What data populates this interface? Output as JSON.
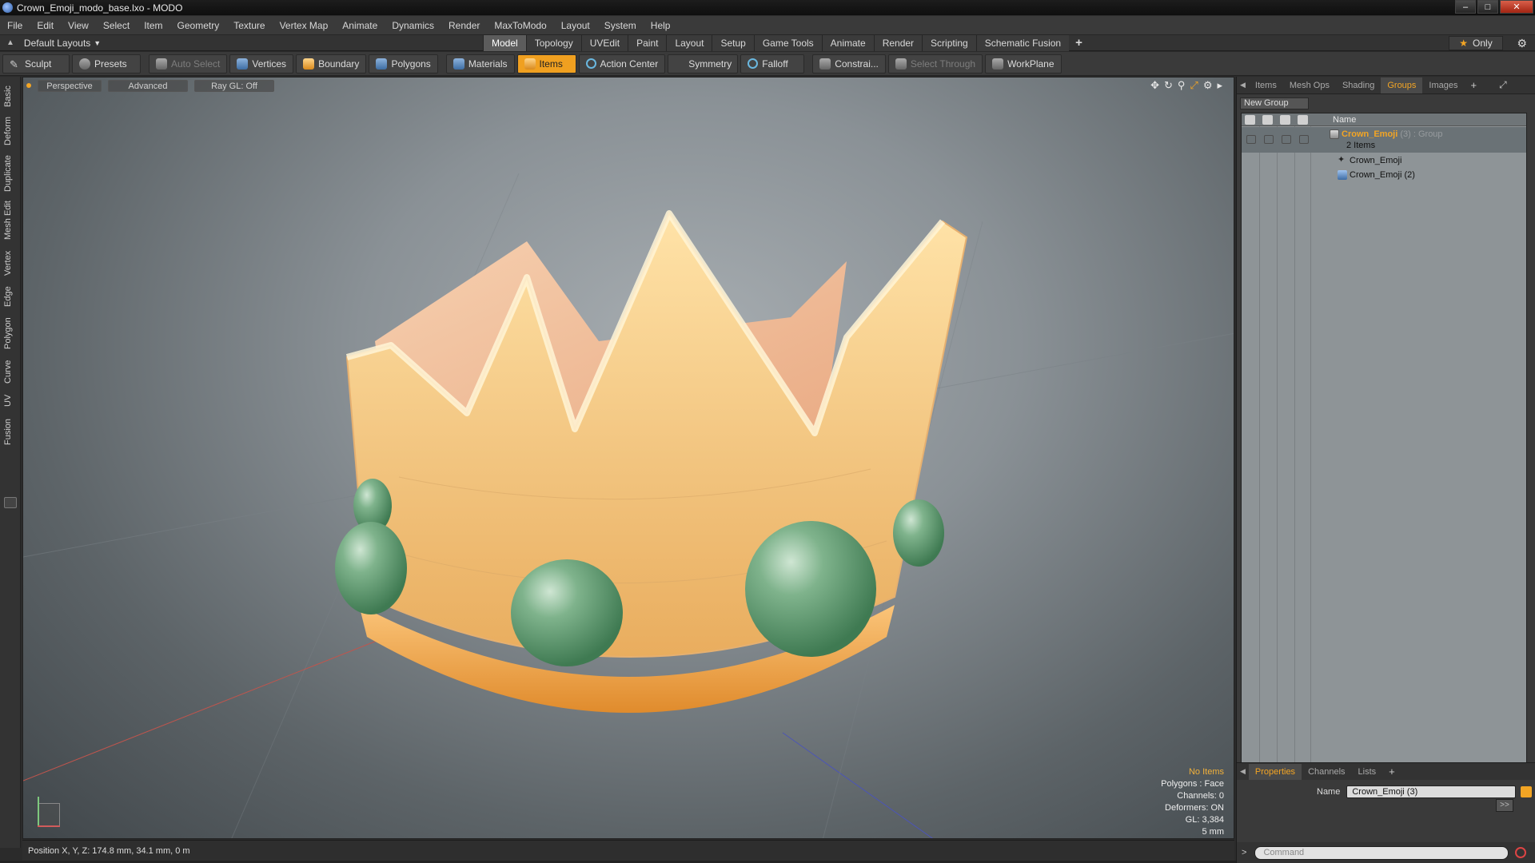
{
  "window": {
    "title": "Crown_Emoji_modo_base.lxo - MODO"
  },
  "menu": [
    "File",
    "Edit",
    "View",
    "Select",
    "Item",
    "Geometry",
    "Texture",
    "Vertex Map",
    "Animate",
    "Dynamics",
    "Render",
    "MaxToModo",
    "Layout",
    "System",
    "Help"
  ],
  "layout": {
    "selector": "Default Layouts",
    "tabs": [
      "Model",
      "Topology",
      "UVEdit",
      "Paint",
      "Layout",
      "Setup",
      "Game Tools",
      "Animate",
      "Render",
      "Scripting",
      "Schematic Fusion"
    ],
    "active_tab": "Model",
    "only_label": "Only"
  },
  "toolbar": {
    "sculpt": "Sculpt",
    "presets": "Presets",
    "auto_select": "Auto Select",
    "vertices": "Vertices",
    "boundary": "Boundary",
    "polygons": "Polygons",
    "materials": "Materials",
    "items": "Items",
    "action_center": "Action Center",
    "symmetry": "Symmetry",
    "falloff": "Falloff",
    "constraints": "Constrai...",
    "select_through": "Select Through",
    "workplane": "WorkPlane"
  },
  "left_tabs": [
    "Basic",
    "Deform",
    "Duplicate",
    "Mesh Edit",
    "Vertex",
    "Edge",
    "Polygon",
    "Curve",
    "UV",
    "Fusion"
  ],
  "viewport": {
    "view_mode": "Perspective",
    "shading": "Advanced",
    "raygl": "Ray GL: Off",
    "info": {
      "selection": "No Items",
      "polygons": "Polygons : Face",
      "channels": "Channels: 0",
      "deformers": "Deformers: ON",
      "gl": "GL: 3,384",
      "scale": "5 mm"
    },
    "colors": {
      "crown": "#f5c77e",
      "gems": "#6fa87f",
      "band": "#f3a64a"
    }
  },
  "status": {
    "position": "Position X, Y, Z:  174.8 mm, 34.1 mm, 0 m"
  },
  "right_panel": {
    "tabs": [
      "Items",
      "Mesh Ops",
      "Shading",
      "Groups",
      "Images"
    ],
    "active_tab": "Groups",
    "new_group": "New Group",
    "column_name": "Name",
    "group": {
      "name": "Crown_Emoji",
      "suffix": "(3) : Group",
      "count": "2 Items"
    },
    "children": [
      "Crown_Emoji",
      "Crown_Emoji (2)"
    ],
    "props_tabs": [
      "Properties",
      "Channels",
      "Lists"
    ],
    "props_active": "Properties",
    "name_label": "Name",
    "name_value": "Crown_Emoji (3)",
    "more_btn": ">>",
    "command_placeholder": "Command"
  }
}
